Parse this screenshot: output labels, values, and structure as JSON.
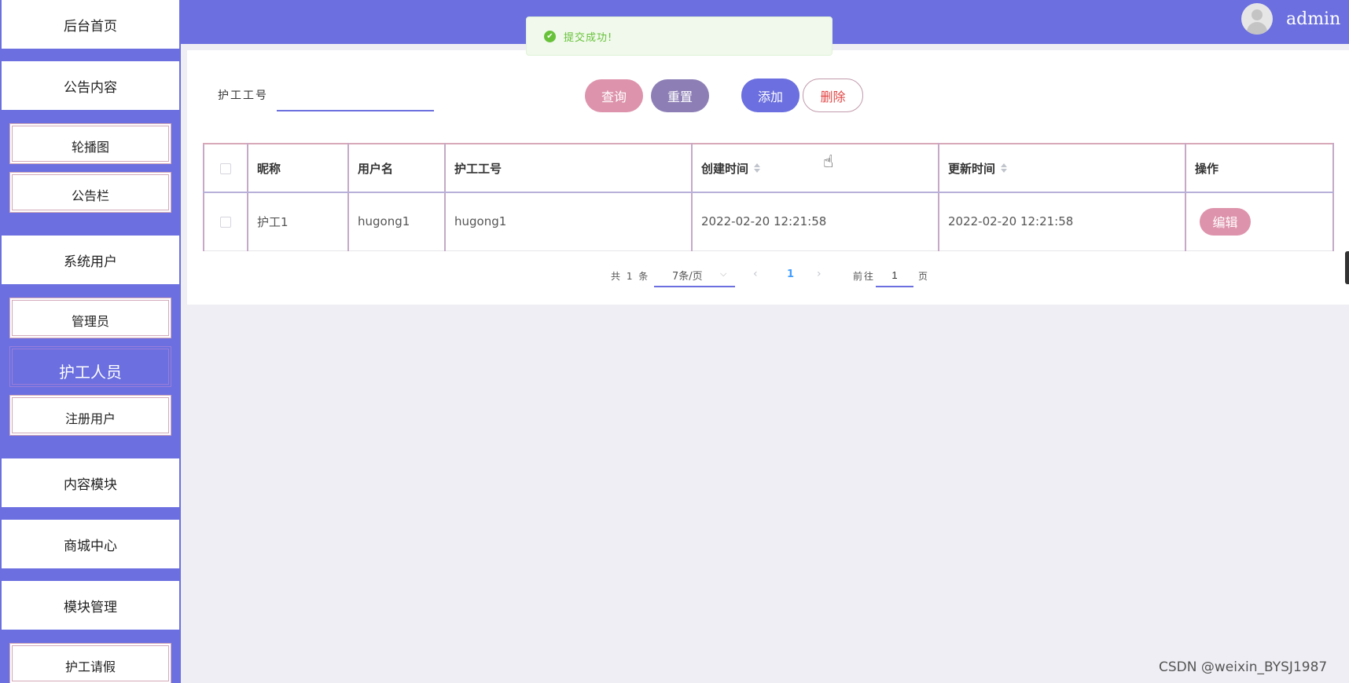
{
  "sidebar": {
    "home": "后台首页",
    "notice_group": "公告内容",
    "carousel": "轮播图",
    "bulletin": "公告栏",
    "sysuser_group": "系统用户",
    "admin": "管理员",
    "nurse": "护工人员",
    "registered": "注册用户",
    "content_group": "内容模块",
    "mall_group": "商城中心",
    "module_group": "模块管理",
    "leave": "护工请假"
  },
  "header": {
    "username": "admin",
    "toast": "提交成功!"
  },
  "search": {
    "label": "护工工号",
    "value": "",
    "query_label": "查询",
    "reset_label": "重置",
    "add_label": "添加",
    "delete_label": "删除"
  },
  "table": {
    "columns": [
      "昵称",
      "用户名",
      "护工工号",
      "创建时间",
      "更新时间",
      "操作"
    ],
    "rows": [
      {
        "nickname": "护工1",
        "username": "hugong1",
        "worker_no": "hugong1",
        "created": "2022-02-20 12:21:58",
        "updated": "2022-02-20 12:21:58",
        "edit_label": "编辑"
      }
    ]
  },
  "pagination": {
    "total": "共 1 条",
    "page_size": "7条/页",
    "current": "1",
    "goto_prefix": "前往",
    "goto_value": "1",
    "goto_suffix": "页"
  },
  "watermark": "CSDN @weixin_BYSJ1987",
  "colors": {
    "primary": "#6b6fdf",
    "pink": "#dd93ab",
    "mauve": "#8d7fb6",
    "success": "#67c23a",
    "danger": "#e24646"
  }
}
